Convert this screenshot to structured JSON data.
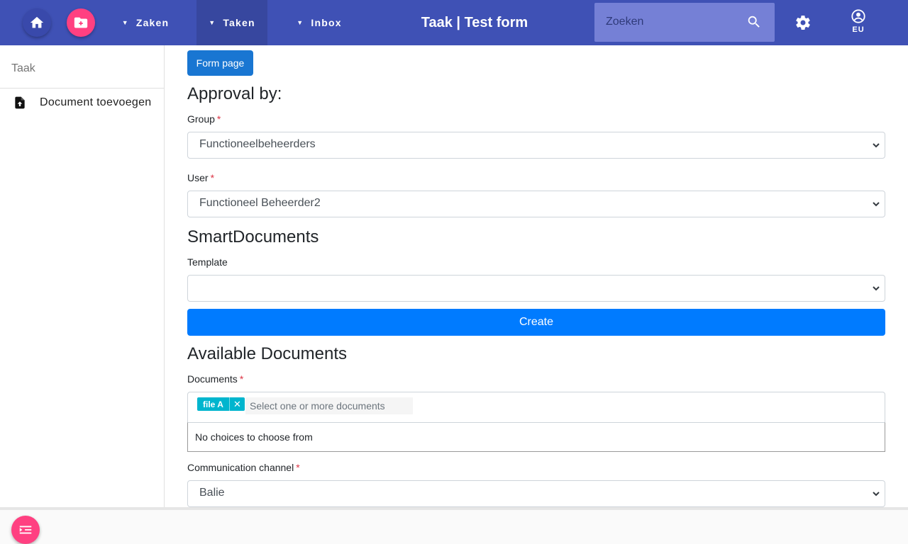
{
  "header": {
    "menu": [
      "Zaken",
      "Taken",
      "Inbox"
    ],
    "title": "Taak | Test form",
    "search_placeholder": "Zoeken",
    "user_label": "EU",
    "color": "#3f51b5"
  },
  "sidebar": {
    "title": "Taak",
    "items": [
      {
        "label": "Document toevoegen",
        "icon": "upload-file-icon"
      }
    ]
  },
  "content": {
    "form_page_button": "Form page",
    "approval_heading": "Approval by:",
    "group_label": "Group",
    "group_value": "Functioneelbeheerders",
    "user_label": "User",
    "user_value": "Functioneel Beheerder2",
    "smart_heading": "SmartDocuments",
    "template_label": "Template",
    "template_value": "",
    "create_button": "Create",
    "available_heading": "Available Documents",
    "documents_label": "Documents",
    "documents_tag": "file A",
    "documents_placeholder": "Select one or more documents",
    "no_choices": "No choices to choose from",
    "channel_label": "Communication channel",
    "channel_value": "Balie",
    "required_mark": "*"
  }
}
